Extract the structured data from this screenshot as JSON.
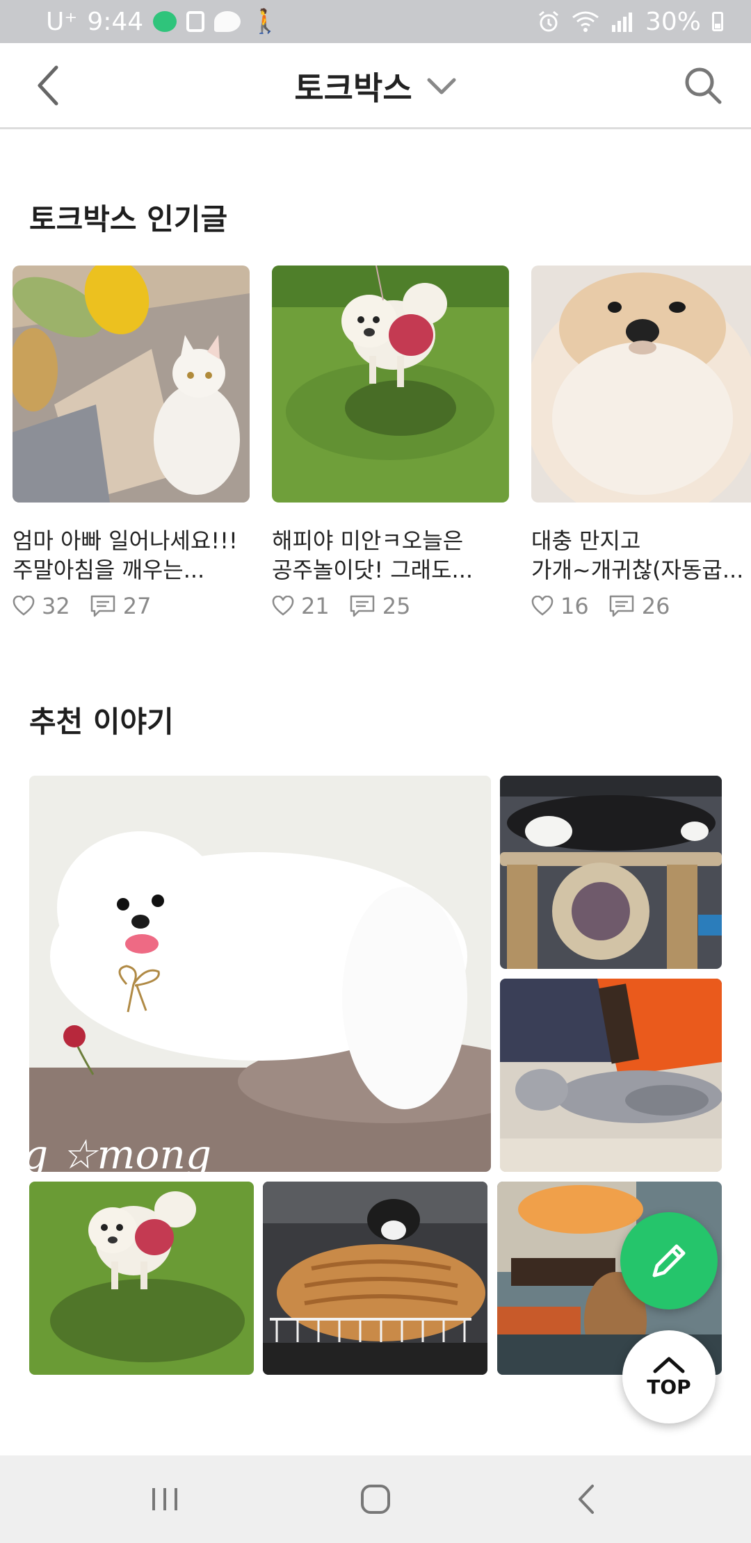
{
  "status_bar": {
    "carrier": "U⁺",
    "time": "9:44",
    "battery": "30%",
    "notification_icons": [
      "cat-app-icon",
      "square-app-icon",
      "talk-icon",
      "walking-icon"
    ],
    "system_icons": [
      "alarm-icon",
      "wifi-icon",
      "signal-icon",
      "battery-icon"
    ]
  },
  "header": {
    "title": "토크박스",
    "back_icon": "chevron-left-icon",
    "dropdown_icon": "chevron-down-icon",
    "search_icon": "search-icon"
  },
  "popular": {
    "section_title": "토크박스 인기글",
    "posts": [
      {
        "line1": "엄마 아빠 일어나세요!!!",
        "line2": "주말아침을 깨우는...",
        "likes": "32",
        "comments": "27",
        "image": "white cat on rug"
      },
      {
        "line1": "해피야 미안ㅋ오늘은",
        "line2": "공주놀이닷! 그래도...",
        "likes": "21",
        "comments": "25",
        "image": "pomeranian on grass"
      },
      {
        "line1": "대충 만지고",
        "line2": "가개~개귀찮(자동굽...",
        "likes": "16",
        "comments": "26",
        "image": "pomeranian close-up"
      }
    ]
  },
  "recommended": {
    "section_title": "추천 이야기",
    "featured_caption": "g ☆mong",
    "tiles": [
      "white pomeranian",
      "black and white cat on cat tower",
      "grey kitten",
      "pomeranian on grass",
      "tabby cat in basket",
      "cat under table"
    ]
  },
  "fab": {
    "write_icon": "pencil-icon",
    "top_label": "TOP"
  },
  "colors": {
    "accent_green": "#25c56b",
    "status_bar_bg": "#c8c9cc",
    "meta_gray": "#8a8a8a"
  }
}
